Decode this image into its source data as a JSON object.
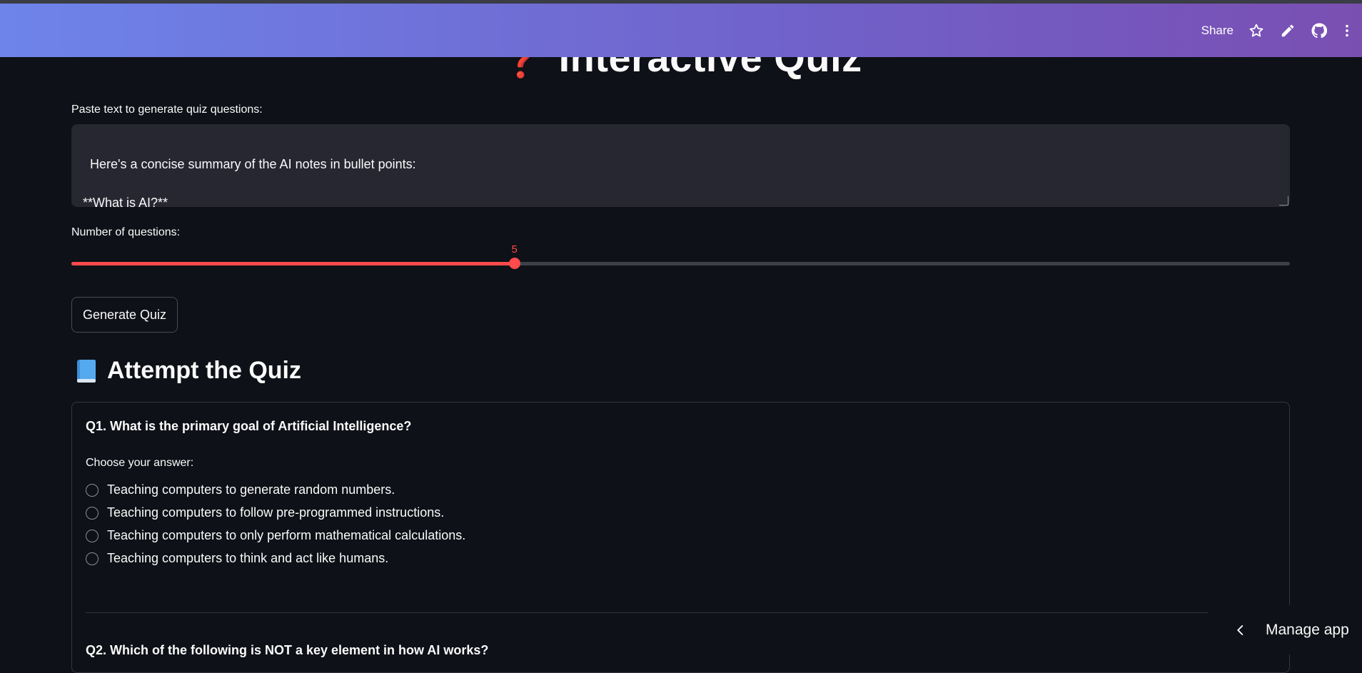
{
  "header": {
    "share_label": "Share",
    "icons": [
      "star-icon",
      "pencil-icon",
      "github-icon",
      "more-vertical-icon"
    ]
  },
  "page": {
    "title": "Interactive Quiz",
    "title_icon": "red-question-mark-icon"
  },
  "input": {
    "label": "Paste text to generate quiz questions:",
    "value": "Here's a concise summary of the AI notes in bullet points:\n\n**What is AI?**"
  },
  "slider": {
    "label": "Number of questions:",
    "value": 5,
    "min": 1,
    "max": 12,
    "accent": "#ff4b4b"
  },
  "generate_button": {
    "label": "Generate Quiz"
  },
  "section": {
    "title": "Attempt the Quiz",
    "icon": "blue-book-icon"
  },
  "quiz": {
    "q1": {
      "title": "Q1. What is the primary goal of Artificial Intelligence?",
      "choose_label": "Choose your answer:",
      "options": [
        "Teaching computers to generate random numbers.",
        "Teaching computers to follow pre-programmed instructions.",
        "Teaching computers to only perform mathematical calculations.",
        "Teaching computers to think and act like humans."
      ]
    },
    "q2": {
      "title": "Q2. Which of the following is NOT a key element in how AI works?"
    }
  },
  "manage_app": {
    "label": "Manage app",
    "icon": "chevron-left-icon"
  }
}
